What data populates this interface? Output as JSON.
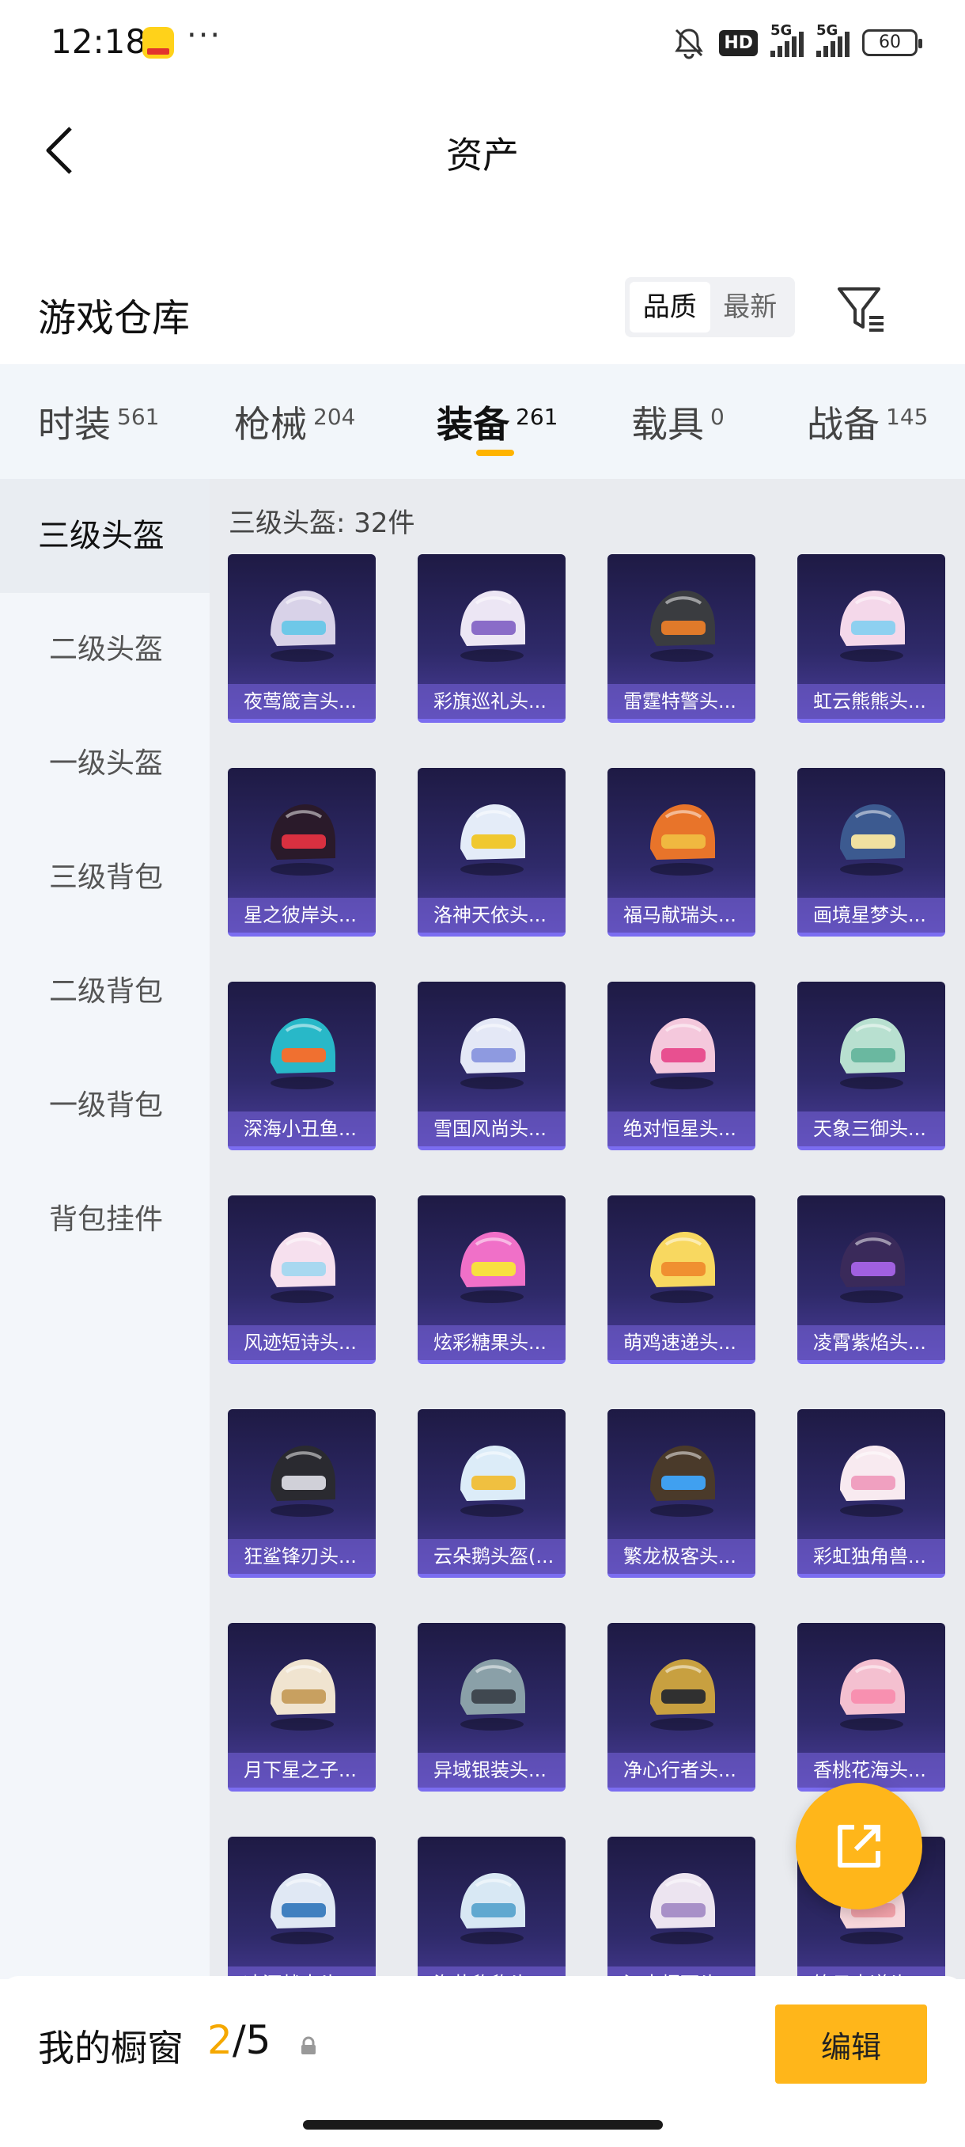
{
  "status_bar": {
    "time": "12:18",
    "dots": "···",
    "hd": "HD",
    "net1": "5G",
    "net2": "5G",
    "battery": "60"
  },
  "header": {
    "title": "资产",
    "back_icon": "chevron-left-icon"
  },
  "warehouse": {
    "title": "游戏仓库",
    "sort_options": [
      "品质",
      "最新"
    ],
    "selected_sort": "品质",
    "filter_icon": "filter-icon"
  },
  "tabs": [
    {
      "label": "时装",
      "count": "561"
    },
    {
      "label": "枪械",
      "count": "204"
    },
    {
      "label": "装备",
      "count": "261"
    },
    {
      "label": "载具",
      "count": "0"
    },
    {
      "label": "战备",
      "count": "145"
    }
  ],
  "active_tab": "装备",
  "sidebar": {
    "items": [
      "三级头盔",
      "二级头盔",
      "一级头盔",
      "三级背包",
      "二级背包",
      "一级背包",
      "背包挂件"
    ],
    "active": "三级头盔"
  },
  "grid": {
    "label": "三级头盔: 32件",
    "items": [
      {
        "name": "夜莺箴言头...",
        "color": "#d8d2e8",
        "accent": "#6ec8e8"
      },
      {
        "name": "彩旗巡礼头...",
        "color": "#ece6f4",
        "accent": "#8a6cc8"
      },
      {
        "name": "雷霆特警头...",
        "color": "#3a3c40",
        "accent": "#e07a2a"
      },
      {
        "name": "虹云熊熊头...",
        "color": "#f4d8ea",
        "accent": "#8ed0f0"
      },
      {
        "name": "星之彼岸头...",
        "color": "#2a1a2a",
        "accent": "#d83040"
      },
      {
        "name": "洛神天依头...",
        "color": "#e4ecf8",
        "accent": "#f0c830"
      },
      {
        "name": "福马献瑞头...",
        "color": "#e8742a",
        "accent": "#f0b840"
      },
      {
        "name": "画境星梦头...",
        "color": "#3c5a90",
        "accent": "#f0e0a0"
      },
      {
        "name": "深海小丑鱼...",
        "color": "#28b8c8",
        "accent": "#f07030"
      },
      {
        "name": "雪国风尚头...",
        "color": "#e4e8f6",
        "accent": "#8e9ae0"
      },
      {
        "name": "绝对恒星头...",
        "color": "#f4c8dc",
        "accent": "#e85090"
      },
      {
        "name": "天象三御头...",
        "color": "#b8e0d0",
        "accent": "#6ab8a0"
      },
      {
        "name": "风迹短诗头...",
        "color": "#f6e0ee",
        "accent": "#a8d8f0"
      },
      {
        "name": "炫彩糖果头...",
        "color": "#f070c8",
        "accent": "#f8e040"
      },
      {
        "name": "萌鸡速递头...",
        "color": "#f8d860",
        "accent": "#f09030"
      },
      {
        "name": "凌霄紫焰头...",
        "color": "#3a2a5a",
        "accent": "#a060e0"
      },
      {
        "name": "狂鲨锋刃头...",
        "color": "#2a2a30",
        "accent": "#d0d0d8"
      },
      {
        "name": "云朵鹅头盔(...",
        "color": "#dcecf8",
        "accent": "#f0c040"
      },
      {
        "name": "繁龙极客头...",
        "color": "#4a3a2a",
        "accent": "#40a0f0"
      },
      {
        "name": "彩虹独角兽...",
        "color": "#f8eaf0",
        "accent": "#f0a0c0"
      },
      {
        "name": "月下星之子...",
        "color": "#f0e4d0",
        "accent": "#c8a060"
      },
      {
        "name": "异域银装头...",
        "color": "#8aa0a8",
        "accent": "#404850"
      },
      {
        "name": "净心行者头...",
        "color": "#c8a040",
        "accent": "#303030"
      },
      {
        "name": "香桃花海头...",
        "color": "#f4c0d0",
        "accent": "#f890b0"
      },
      {
        "name": "冰河战士头...",
        "color": "#e0e8f4",
        "accent": "#4080c0"
      },
      {
        "name": "海盐豹豹头...",
        "color": "#d8e8f4",
        "accent": "#60a8d0"
      },
      {
        "name": "江南烟雨头...",
        "color": "#ece4f0",
        "accent": "#a890c8"
      },
      {
        "name": "笛云太道头...",
        "color": "#f8d8dc",
        "accent": "#f0a0a8"
      }
    ]
  },
  "share_icon": "share-external-icon",
  "bottom_bar": {
    "title": "我的橱窗",
    "current": "2",
    "total": "5",
    "lock_icon": "lock-icon",
    "edit_label": "编辑"
  }
}
